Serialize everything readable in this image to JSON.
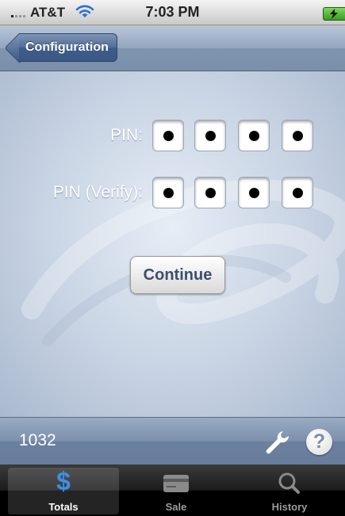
{
  "status_bar": {
    "carrier": "AT&T",
    "time": "7:03 PM",
    "icons": [
      "signal-bars-icon",
      "wifi-icon",
      "battery-icon"
    ]
  },
  "nav_bar": {
    "back_label": "Configuration"
  },
  "pin_form": {
    "pin_label": "PIN:",
    "pin_verify_label": "PIN (Verify):",
    "pin_digits_entered": 4,
    "pin_verify_digits_entered": 4,
    "continue_label": "Continue"
  },
  "toolbar": {
    "value": "1032",
    "icons": [
      "wrench-icon",
      "help-icon"
    ],
    "help_glyph": "?"
  },
  "tab_bar": {
    "tabs": [
      {
        "label": "Totals",
        "icon": "dollar-icon",
        "active": true
      },
      {
        "label": "Sale",
        "icon": "credit-card-icon",
        "active": false
      },
      {
        "label": "History",
        "icon": "search-icon",
        "active": false
      }
    ],
    "dollar_glyph": "$"
  },
  "colors": {
    "accent": "#3a5785",
    "continue_text": "#3b4e6d",
    "battery_green": "#4fb733"
  }
}
